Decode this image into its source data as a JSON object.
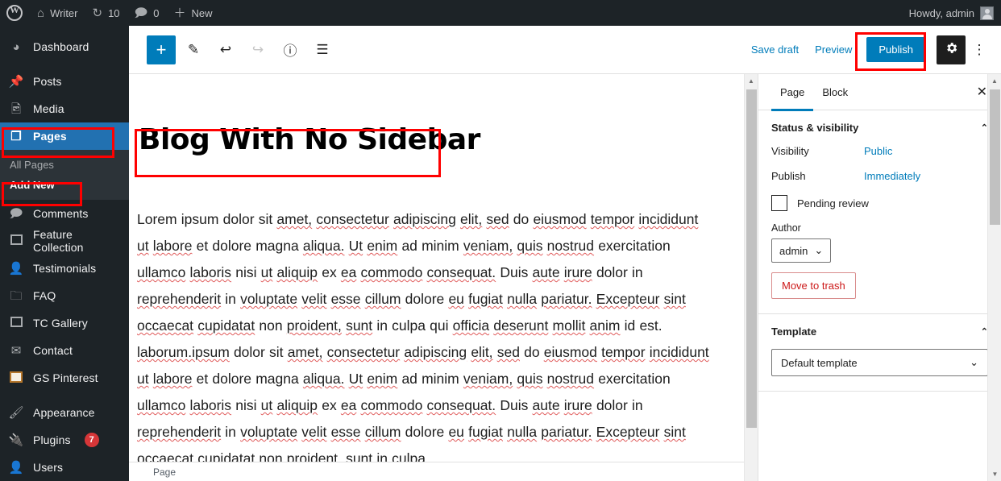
{
  "colors": {
    "admin_bar_bg": "#1d2327",
    "menu_current_bg": "#2271b1",
    "accent_blue": "#007cba",
    "badge_red": "#d63638",
    "annotation_red": "#ff0000",
    "trash_red": "#cc1818"
  },
  "admin_bar": {
    "logo_icon": "wordpress-logo-icon",
    "site_icon": "home-icon",
    "site_name": "Writer",
    "updates_icon": "updates-icon",
    "updates_count": "10",
    "comments_icon": "comment-bubble-icon",
    "comments_count": "0",
    "new_icon": "plus-icon",
    "new_label": "New",
    "howdy": "Howdy, admin",
    "avatar_icon": "avatar-icon"
  },
  "sidebar": {
    "items": [
      {
        "label": "Dashboard",
        "icon": "dashboard-icon",
        "glyph": "◔",
        "current": false
      },
      {
        "label": "Posts",
        "icon": "pin-icon",
        "glyph": "✒",
        "current": false
      },
      {
        "label": "Media",
        "icon": "media-icon",
        "glyph": "♫",
        "current": false
      },
      {
        "label": "Pages",
        "icon": "pages-icon",
        "glyph": "❐",
        "current": true
      },
      {
        "label": "Comments",
        "icon": "comment-bubble-icon",
        "glyph": "🗩",
        "current": false
      },
      {
        "label": "Feature Collection",
        "icon": "collection-icon",
        "glyph": "❐",
        "current": false
      },
      {
        "label": "Testimonials",
        "icon": "person-icon",
        "glyph": "●",
        "current": false
      },
      {
        "label": "FAQ",
        "icon": "folder-icon",
        "glyph": "▰",
        "current": false
      },
      {
        "label": "TC Gallery",
        "icon": "gallery-icon",
        "glyph": "❐",
        "current": false
      },
      {
        "label": "Contact",
        "icon": "envelope-icon",
        "glyph": "✉",
        "current": false
      },
      {
        "label": "GS Pinterest",
        "icon": "gs-pinterest-icon",
        "glyph": "▣",
        "current": false
      },
      {
        "label": "Appearance",
        "icon": "brush-icon",
        "glyph": "✄",
        "current": false
      },
      {
        "label": "Plugins",
        "icon": "plug-icon",
        "glyph": "⚡",
        "current": false,
        "badge": "7"
      },
      {
        "label": "Users",
        "icon": "users-icon",
        "glyph": "●",
        "current": false
      }
    ],
    "submenu": {
      "parent": "Pages",
      "items": [
        {
          "label": "All Pages",
          "current": false
        },
        {
          "label": "Add New",
          "current": true
        }
      ]
    }
  },
  "editor_header": {
    "tools": [
      {
        "name": "add-block-button",
        "glyph": "+",
        "label": "Add block",
        "state": "primary"
      },
      {
        "name": "edit-tools-button",
        "glyph": "✎",
        "label": "Tools",
        "state": "normal"
      },
      {
        "name": "undo-button",
        "glyph": "↩",
        "label": "Undo",
        "state": "normal"
      },
      {
        "name": "redo-button",
        "glyph": "↪",
        "label": "Redo",
        "state": "disabled"
      },
      {
        "name": "details-button",
        "glyph": "ⓘ",
        "label": "Details",
        "state": "normal"
      },
      {
        "name": "list-view-button",
        "glyph": "☰",
        "label": "List view",
        "state": "normal"
      }
    ],
    "save_draft_label": "Save draft",
    "preview_label": "Preview",
    "publish_label": "Publish",
    "settings_icon": "gear-icon",
    "more_options_icon": "vertical-ellipsis-icon"
  },
  "content": {
    "title": "Blog With No Sidebar",
    "paragraph": "Lorem ipsum dolor sit amet, consectetur adipiscing elit, sed do eiusmod tempor incididunt ut labore et dolore magna aliqua. Ut enim ad minim veniam, quis nostrud exercitation ullamco laboris nisi ut aliquip ex ea commodo consequat. Duis aute irure dolor in reprehenderit in voluptate velit esse cillum dolore eu fugiat nulla pariatur. Excepteur sint occaecat cupidatat non proident, sunt in culpa qui officia deserunt mollit anim id est. laborum.ipsum dolor sit amet, consectetur adipiscing elit, sed do eiusmod tempor incididunt ut labore et dolore magna aliqua. Ut enim ad minim veniam, quis nostrud exercitation ullamco laboris nisi ut aliquip ex ea commodo consequat. Duis aute irure dolor in reprehenderit in voluptate velit esse cillum dolore eu fugiat nulla pariatur. Excepteur sint occaecat cupidatat non proident, sunt in culpa",
    "breadcrumb": "Page"
  },
  "settings_panel": {
    "tabs": [
      {
        "label": "Page",
        "active": true
      },
      {
        "label": "Block",
        "active": false
      }
    ],
    "close_icon": "close-icon",
    "status_section": {
      "title": "Status & visibility",
      "collapse_icon": "chevron-up-icon",
      "visibility_label": "Visibility",
      "visibility_value": "Public",
      "publish_label": "Publish",
      "publish_value": "Immediately",
      "pending_review_label": "Pending review",
      "pending_review_checked": false,
      "author_label": "Author",
      "author_value": "admin",
      "move_to_trash_label": "Move to trash"
    },
    "template_section": {
      "title": "Template",
      "collapse_icon": "chevron-up-icon",
      "value": "Default template"
    }
  },
  "annotations": [
    {
      "name": "annotation-pages-menu",
      "target": "Pages"
    },
    {
      "name": "annotation-add-new-submenu",
      "target": "Add New"
    },
    {
      "name": "annotation-page-title",
      "target": "Blog With No Sidebar"
    },
    {
      "name": "annotation-publish-button",
      "target": "Publish"
    }
  ]
}
